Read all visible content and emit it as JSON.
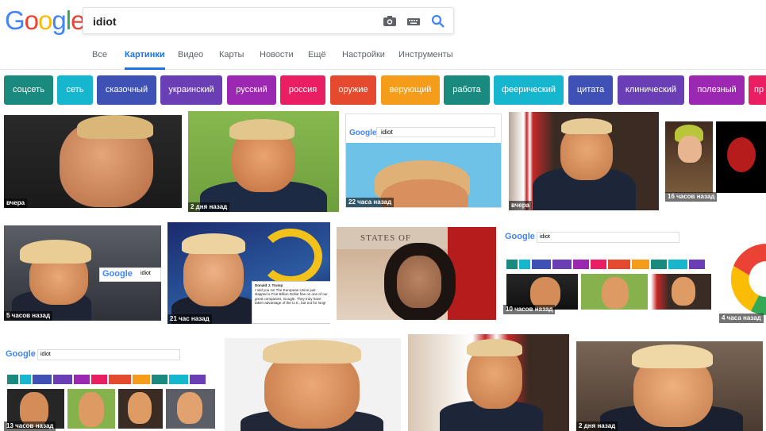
{
  "logo": {
    "letters": [
      "G",
      "o",
      "o",
      "g",
      "l",
      "e"
    ],
    "colors": [
      "#4285f4",
      "#ea4335",
      "#fbbc05",
      "#4285f4",
      "#34a853",
      "#ea4335"
    ]
  },
  "search": {
    "query": "idiot"
  },
  "icons": {
    "camera": "camera-icon",
    "keyboard": "keyboard-icon",
    "search": "search-icon"
  },
  "tabs": [
    {
      "label": "Все",
      "active": false
    },
    {
      "label": "Картинки",
      "active": true
    },
    {
      "label": "Видео",
      "active": false
    },
    {
      "label": "Карты",
      "active": false
    },
    {
      "label": "Новости",
      "active": false
    },
    {
      "label": "Ещё",
      "active": false
    },
    {
      "label": "Настройки",
      "active": false
    },
    {
      "label": "Инструменты",
      "active": false
    }
  ],
  "chips": [
    {
      "label": "соцсеть",
      "color": "#1a8a7f"
    },
    {
      "label": "сеть",
      "color": "#17b6cf"
    },
    {
      "label": "сказочный",
      "color": "#3f51b5"
    },
    {
      "label": "украинский",
      "color": "#6a3fb5"
    },
    {
      "label": "русский",
      "color": "#9c27b0"
    },
    {
      "label": "россия",
      "color": "#e91e63"
    },
    {
      "label": "оружие",
      "color": "#e64a2e"
    },
    {
      "label": "верующий",
      "color": "#f59c1a"
    },
    {
      "label": "работа",
      "color": "#1a8a7f"
    },
    {
      "label": "феерический",
      "color": "#17b6cf"
    },
    {
      "label": "цитата",
      "color": "#3f51b5"
    },
    {
      "label": "клинический",
      "color": "#6a3fb5"
    },
    {
      "label": "полезный",
      "color": "#9c27b0"
    },
    {
      "label": "пр",
      "color": "#e91e63"
    }
  ],
  "results": {
    "row1": [
      "вчера",
      "2 дня назад",
      "22 часа назад",
      "вчера",
      "16 часов назад"
    ],
    "row2": [
      "5 часов назад",
      "21 час назад",
      "",
      "10 часов назад",
      "4 часа назад"
    ],
    "row3": [
      "13 часов назад",
      "",
      "",
      "2 дня назад"
    ]
  },
  "embedded": {
    "google_word": "Google",
    "query": "idiot",
    "tweet": {
      "author": "Donald J. Trump",
      "text": "I told you so! The European Union just slapped a Five Billion Dollar fine on one of our great companies, Google. They truly have taken advantage of the U.S., but not for long!"
    },
    "sign": "STATES OF"
  }
}
